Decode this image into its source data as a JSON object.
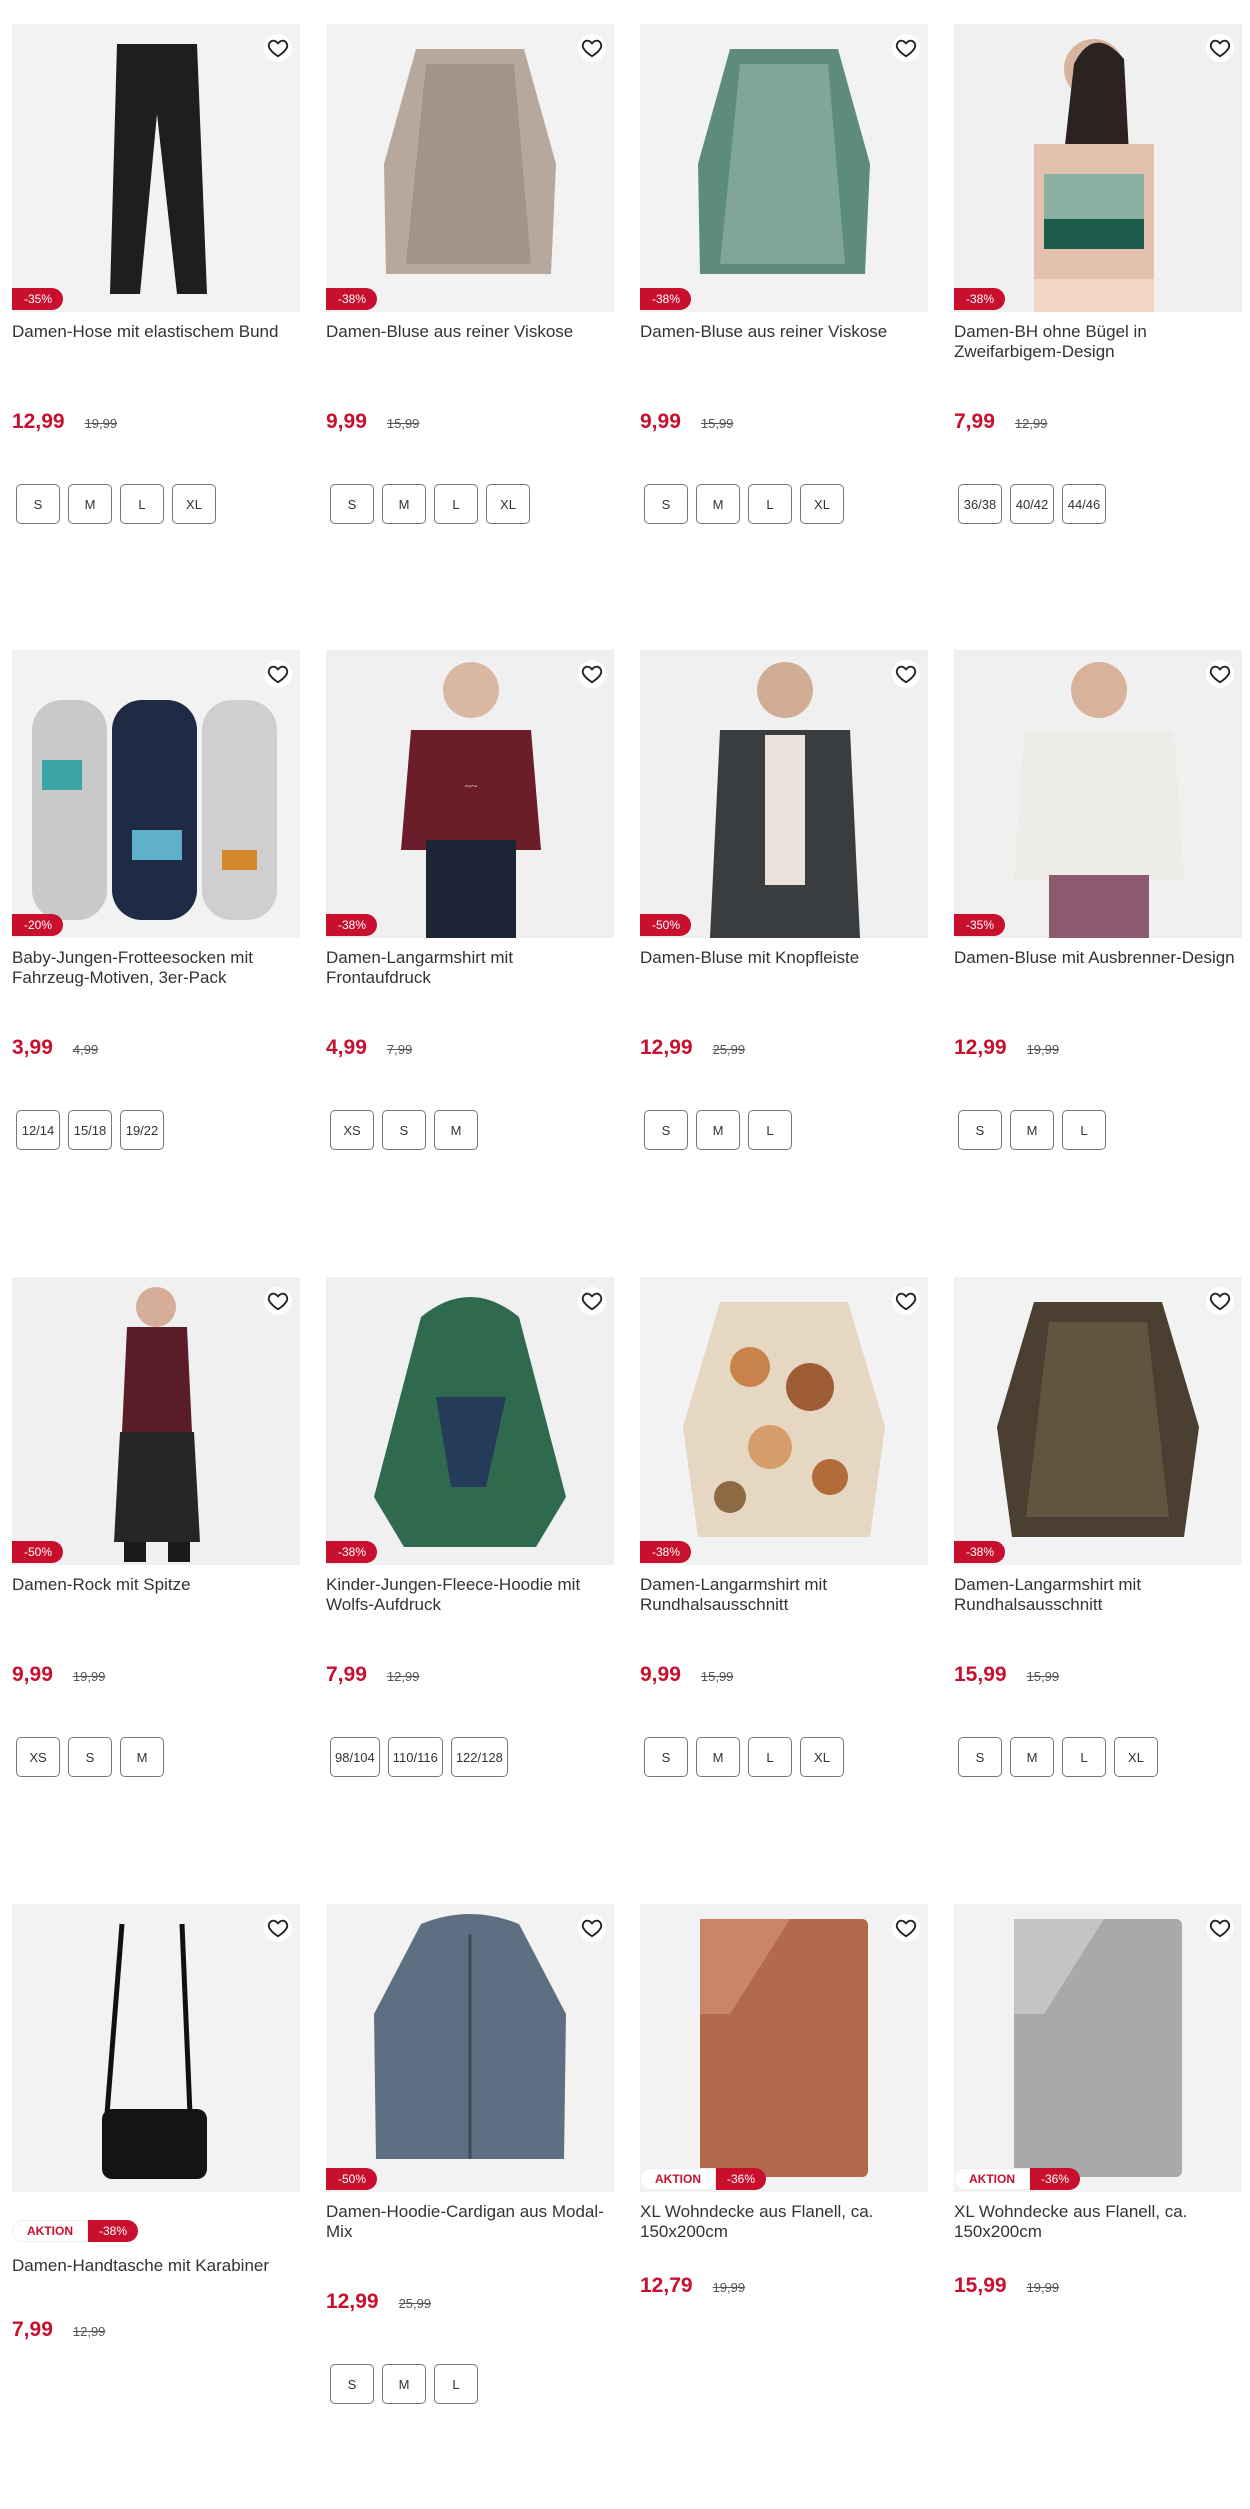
{
  "products": [
    {
      "title": "Damen-Hose mit elastischem Bund",
      "price": "12,99",
      "old_price": "19,99",
      "discount": "-35%",
      "sizes": [
        "S",
        "M",
        "L",
        "XL"
      ]
    },
    {
      "title": "Damen-Bluse aus reiner Viskose",
      "price": "9,99",
      "old_price": "15,99",
      "discount": "-38%",
      "sizes": [
        "S",
        "M",
        "L",
        "XL"
      ]
    },
    {
      "title": "Damen-Bluse aus reiner Viskose",
      "price": "9,99",
      "old_price": "15,99",
      "discount": "-38%",
      "sizes": [
        "S",
        "M",
        "L",
        "XL"
      ]
    },
    {
      "title": "Damen-BH ohne Bügel in Zweifarbigem-Design",
      "price": "7,99",
      "old_price": "12,99",
      "discount": "-38%",
      "sizes": [
        "36/38",
        "40/42",
        "44/46"
      ]
    },
    {
      "title": "Baby-Jungen-Frotteesocken mit Fahrzeug-Motiven, 3er-Pack",
      "price": "3,99",
      "old_price": "4,99",
      "discount": "-20%",
      "sizes": [
        "12/14",
        "15/18",
        "19/22"
      ]
    },
    {
      "title": "Damen-Langarmshirt mit Frontaufdruck",
      "price": "4,99",
      "old_price": "7,99",
      "discount": "-38%",
      "sizes": [
        "XS",
        "S",
        "M"
      ]
    },
    {
      "title": "Damen-Bluse mit Knopfleiste",
      "price": "12,99",
      "old_price": "25,99",
      "discount": "-50%",
      "sizes": [
        "S",
        "M",
        "L"
      ]
    },
    {
      "title": "Damen-Bluse mit Ausbrenner-Design",
      "price": "12,99",
      "old_price": "19,99",
      "discount": "-35%",
      "sizes": [
        "S",
        "M",
        "L"
      ]
    },
    {
      "title": "Damen-Rock mit Spitze",
      "price": "9,99",
      "old_price": "19,99",
      "discount": "-50%",
      "sizes": [
        "XS",
        "S",
        "M"
      ]
    },
    {
      "title": "Kinder-Jungen-Fleece-Hoodie mit Wolfs-Aufdruck",
      "price": "7,99",
      "old_price": "12,99",
      "discount": "-38%",
      "sizes": [
        "98/104",
        "110/116",
        "122/128"
      ]
    },
    {
      "title": "Damen-Langarmshirt mit Rundhalsausschnitt",
      "price": "9,99",
      "old_price": "15,99",
      "discount": "-38%",
      "sizes": [
        "S",
        "M",
        "L",
        "XL"
      ]
    },
    {
      "title": "Damen-Langarmshirt mit Rundhalsausschnitt",
      "price": "15,99",
      "old_price": "15,99",
      "discount": "-38%",
      "sizes": [
        "S",
        "M",
        "L",
        "XL"
      ]
    },
    {
      "title": "Damen-Handtasche mit Karabiner",
      "price": "7,99",
      "old_price": "12,99",
      "discount": "-38%",
      "aktion": "AKTION",
      "sizes": []
    },
    {
      "title": "Damen-Hoodie-Cardigan aus Modal-Mix",
      "price": "12,99",
      "old_price": "25,99",
      "discount": "-50%",
      "sizes": [
        "S",
        "M",
        "L"
      ]
    },
    {
      "title": "XL Wohndecke aus Flanell, ca. 150x200cm",
      "price": "12,79",
      "old_price": "19,99",
      "discount": "-36%",
      "aktion": "AKTION",
      "sizes": []
    },
    {
      "title": "XL Wohndecke aus Flanell, ca. 150x200cm",
      "price": "15,99",
      "old_price": "19,99",
      "discount": "-36%",
      "aktion": "AKTION",
      "sizes": []
    }
  ],
  "colors": {
    "accent": "#c8102e",
    "image_bg": "#f0f0f0"
  },
  "icons": {
    "favorite": "heart-outline-icon"
  }
}
